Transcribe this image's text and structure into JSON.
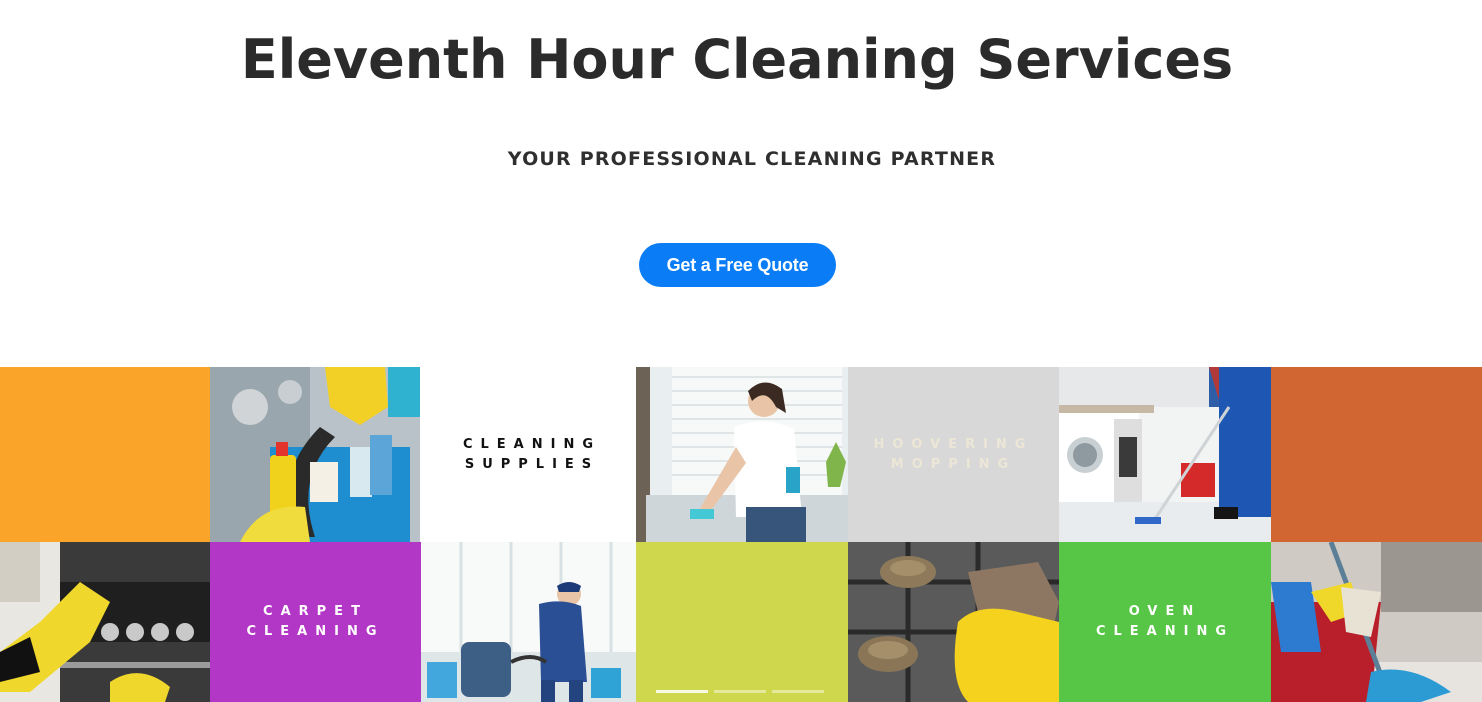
{
  "hero": {
    "title": "Eleventh Hour Cleaning Services",
    "subtitle": "YOUR PROFESSIONAL CLEANING PARTNER",
    "cta_label": "Get a Free Quote",
    "cta_color": "#0a7cf5"
  },
  "gallery": {
    "colors": {
      "orange": "#fba42a",
      "rust": "#d16632",
      "purple": "#b337c6",
      "lime": "#cfd84c",
      "green": "#57c545",
      "light_gray": "#d8d8d8",
      "white": "#ffffff"
    },
    "labels": {
      "cleaning_supplies": "CLEANING\nSUPPLIES",
      "hoovering_mopping": "HOOVERING\nMOPPING",
      "carpet_cleaning": "CARPET\nCLEANING",
      "oven_cleaning": "OVEN\nCLEANING"
    },
    "slider": {
      "count": 3,
      "active": 1
    }
  }
}
